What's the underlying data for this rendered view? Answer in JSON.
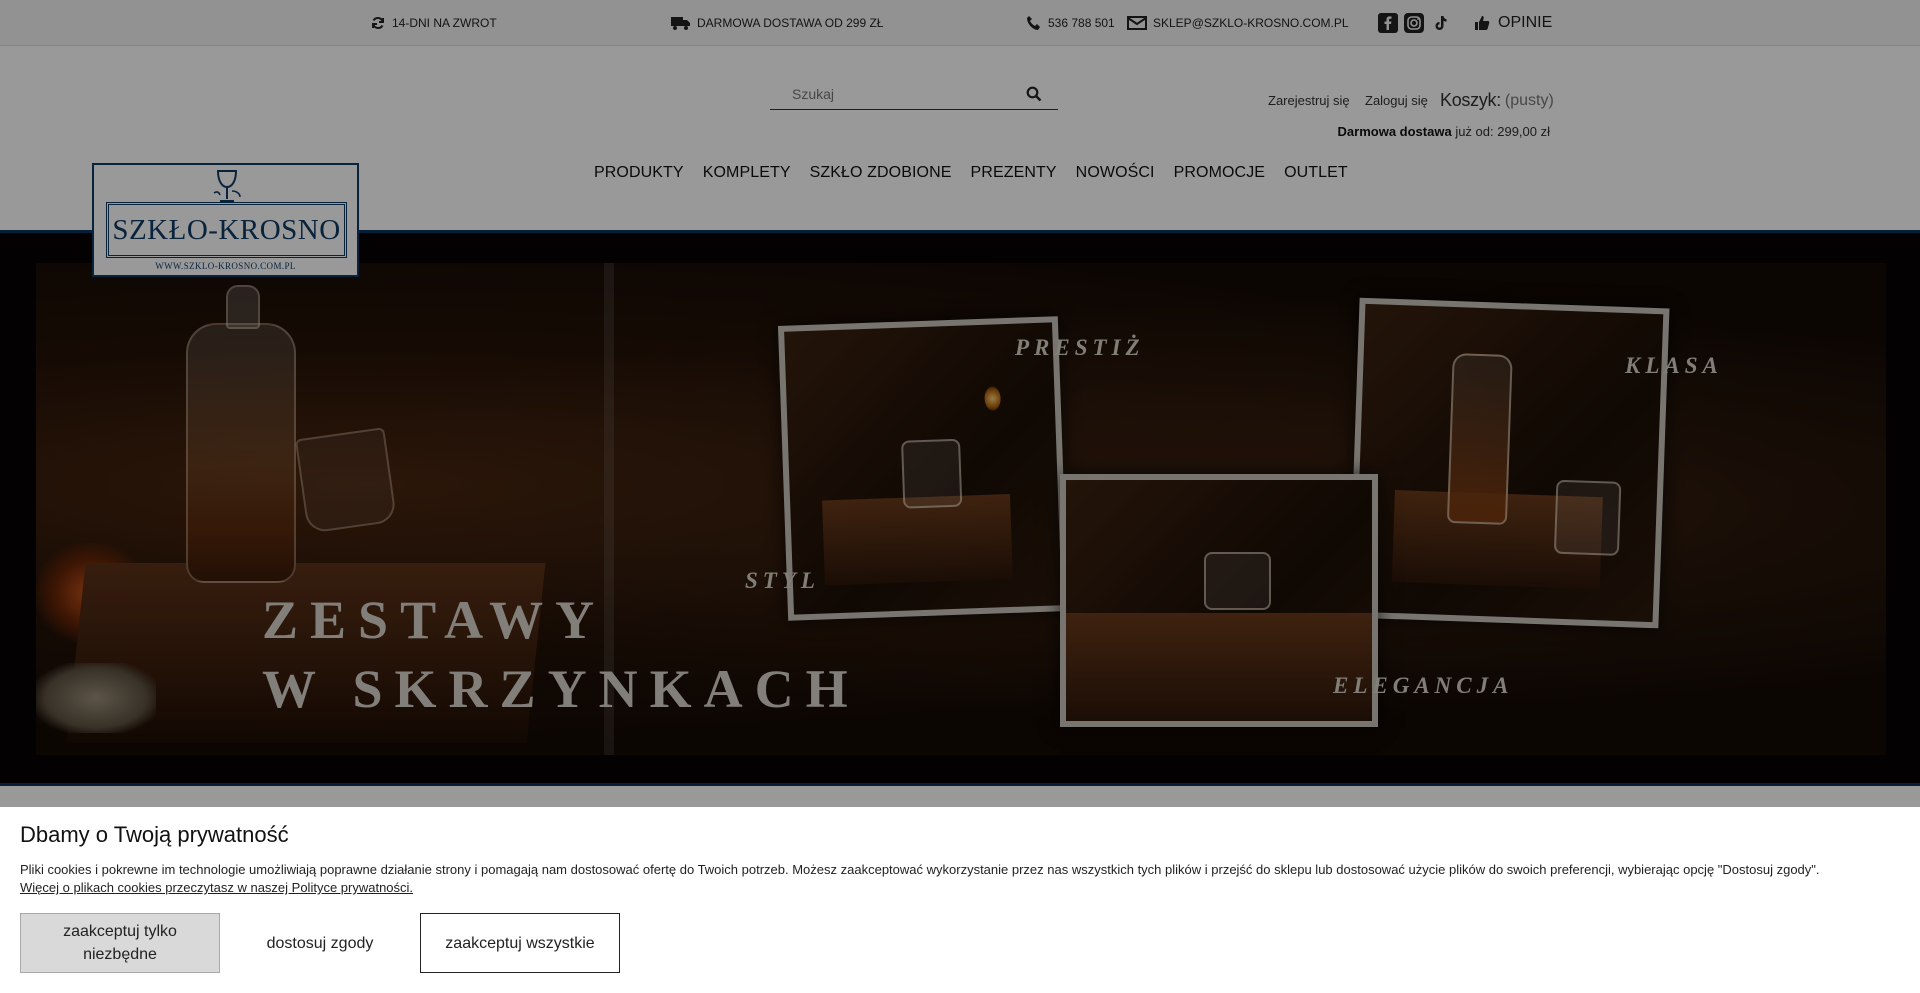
{
  "topbar": {
    "returns": "14-DNI NA ZWROT",
    "delivery": "DARMOWA DOSTAWA OD 299 ZŁ",
    "phone": "536 788 501",
    "email": "SKLEP@SZKLO-KROSNO.COM.PL",
    "reviews": "OPINIE"
  },
  "header": {
    "search_placeholder": "Szukaj",
    "register": "Zarejestruj się",
    "login": "Zaloguj się",
    "cart_label": "Koszyk:",
    "cart_value": "(pusty)",
    "free_delivery_bold": "Darmowa dostawa",
    "free_delivery_rest": " już od: 299,00 zł"
  },
  "logo": {
    "name": "SZKŁO-KROSNO",
    "url": "WWW.SZKLO-KROSNO.COM.PL"
  },
  "nav": [
    "PRODUKTY",
    "KOMPLETY",
    "SZKŁO ZDOBIONE",
    "PREZENTY",
    "NOWOŚCI",
    "PROMOCJE",
    "OUTLET"
  ],
  "hero": {
    "title_line1": "ZESTAWY",
    "title_line2": "W SKRZYNKACH",
    "word_prestiz": "PRESTIŻ",
    "word_klasa": "KLASA",
    "word_styl": "STYL",
    "word_elegancja": "ELEGANCJA"
  },
  "cookie": {
    "title": "Dbamy o Twoją prywatność",
    "text": "Pliki cookies i pokrewne im technologie umożliwiają poprawne działanie strony i pomagają nam dostosować ofertę do Twoich potrzeb. Możesz zaakceptować wykorzystanie przez nas wszystkich tych plików i przejść do sklepu lub dostosować użycie plików do swoich preferencji, wybierając opcję \"Dostosuj zgody\".",
    "link": "Więcej o plikach cookies przeczytasz w naszej Polityce prywatności.",
    "btn_necessary": "zaakceptuj tylko niezbędne",
    "btn_customize": "dostosuj zgody",
    "btn_accept_all": "zaakceptuj wszystkie"
  },
  "icons": {
    "returns": "refresh-icon",
    "delivery": "truck-icon",
    "phone": "phone-icon",
    "email": "envelope-icon",
    "social": [
      "facebook-icon",
      "instagram-icon",
      "tiktok-icon"
    ],
    "reviews": "thumbs-up-icon",
    "search": "search-icon"
  },
  "colors": {
    "brand_navy": "#0f3b66",
    "overlay": "rgba(0,0,0,0.40)",
    "button_grey": "#d9d9d9"
  }
}
